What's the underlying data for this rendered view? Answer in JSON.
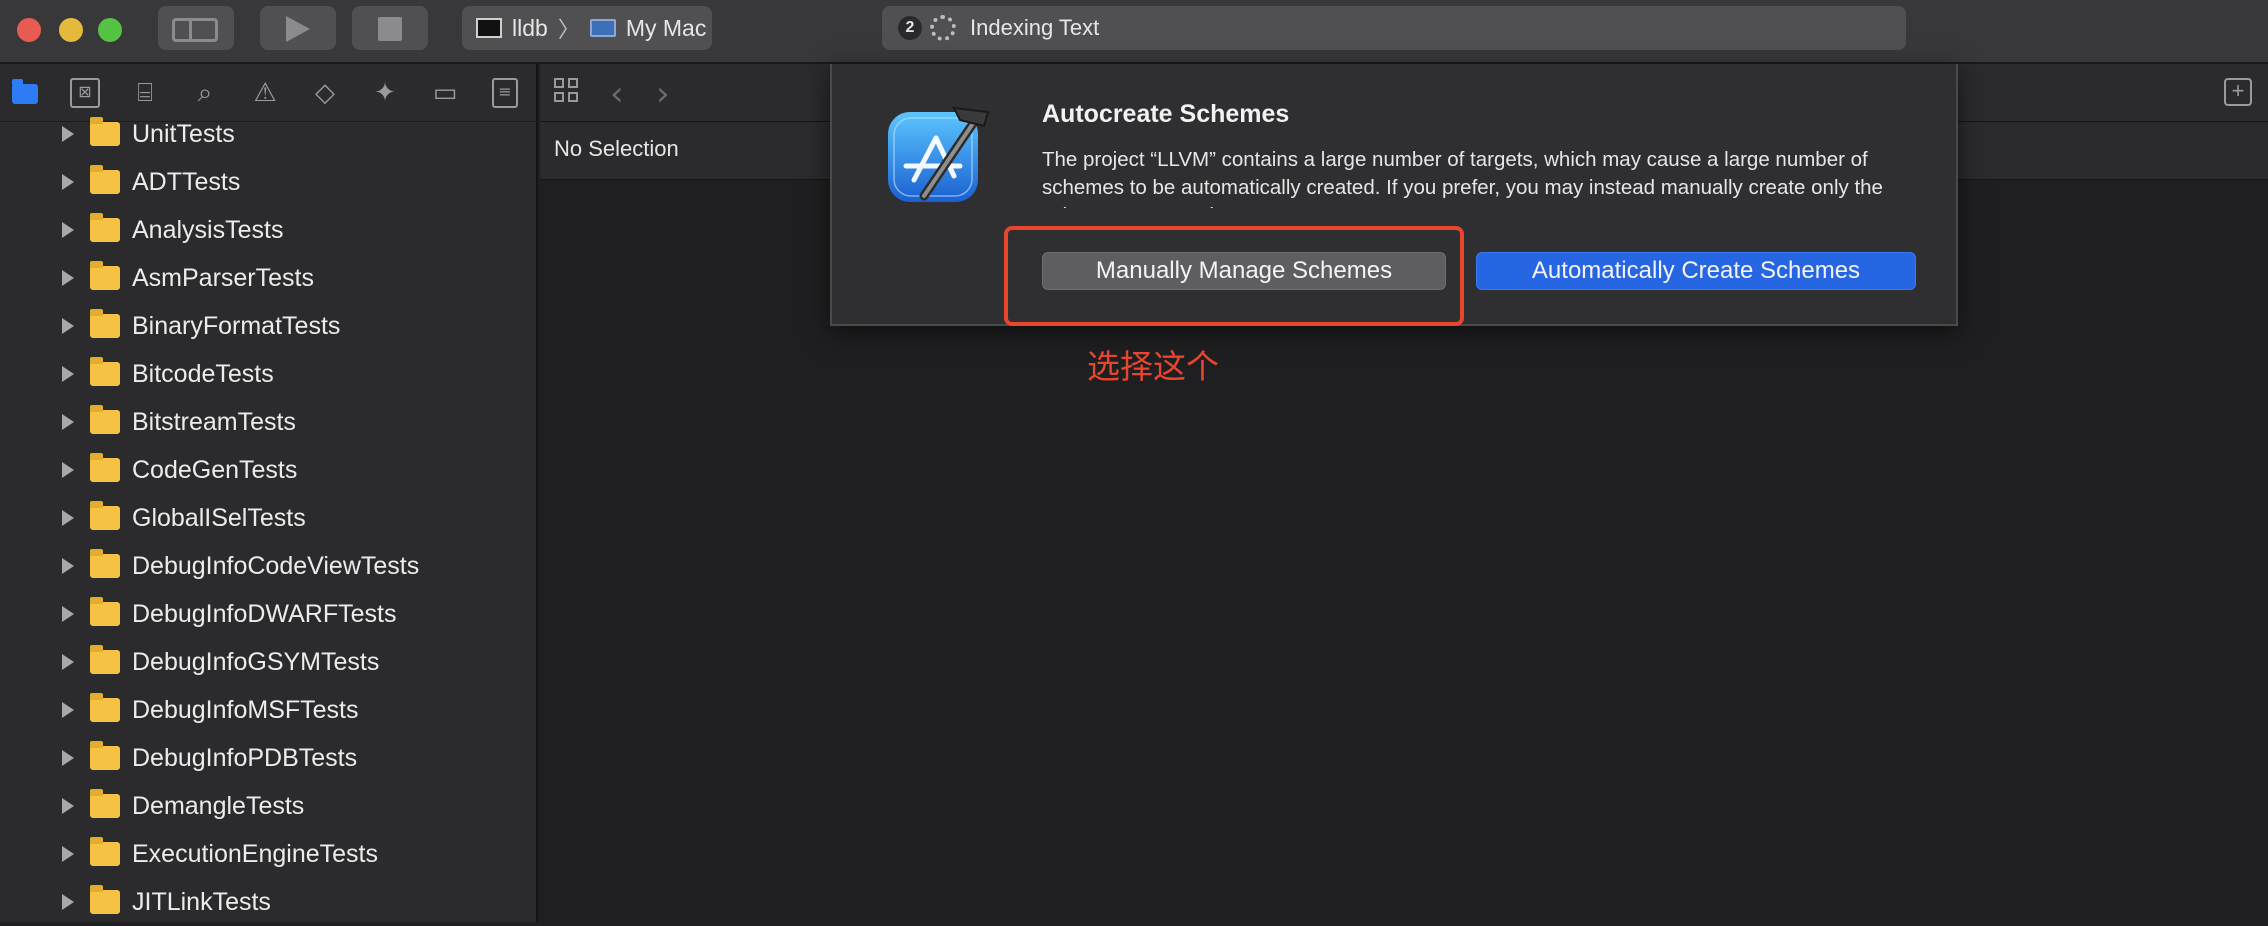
{
  "titlebar": {
    "scheme": "lldb",
    "destination": "My Mac",
    "activity_count": "2",
    "activity_text": "Indexing Text"
  },
  "navigator": {
    "toolbar_icons": [
      "folder-icon",
      "source-control-icon",
      "symbol-icon",
      "search-icon",
      "issue-icon",
      "test-icon",
      "debug-icon",
      "breakpoint-icon",
      "report-icon"
    ],
    "items": [
      {
        "label": "UnitTests"
      },
      {
        "label": "ADTTests"
      },
      {
        "label": "AnalysisTests"
      },
      {
        "label": "AsmParserTests"
      },
      {
        "label": "BinaryFormatTests"
      },
      {
        "label": "BitcodeTests"
      },
      {
        "label": "BitstreamTests"
      },
      {
        "label": "CodeGenTests"
      },
      {
        "label": "GlobalISelTests"
      },
      {
        "label": "DebugInfoCodeViewTests"
      },
      {
        "label": "DebugInfoDWARFTests"
      },
      {
        "label": "DebugInfoGSYMTests"
      },
      {
        "label": "DebugInfoMSFTests"
      },
      {
        "label": "DebugInfoPDBTests"
      },
      {
        "label": "DemangleTests"
      },
      {
        "label": "ExecutionEngineTests"
      },
      {
        "label": "JITLinkTests"
      }
    ]
  },
  "editor": {
    "breadcrumb": "No Selection"
  },
  "dialog": {
    "title": "Autocreate Schemes",
    "message": "The project “LLVM” contains a large number of targets, which may cause a large number of schemes to be automatically created. If you prefer, you may instead manually create only the schemes you need.",
    "secondary_button": "Manually Manage Schemes",
    "primary_button": "Automatically Create Schemes"
  },
  "annotation": {
    "text": "选择这个",
    "color": "#e8452f"
  },
  "colors": {
    "accent": "#2766e2",
    "folder": "#f6c244"
  }
}
